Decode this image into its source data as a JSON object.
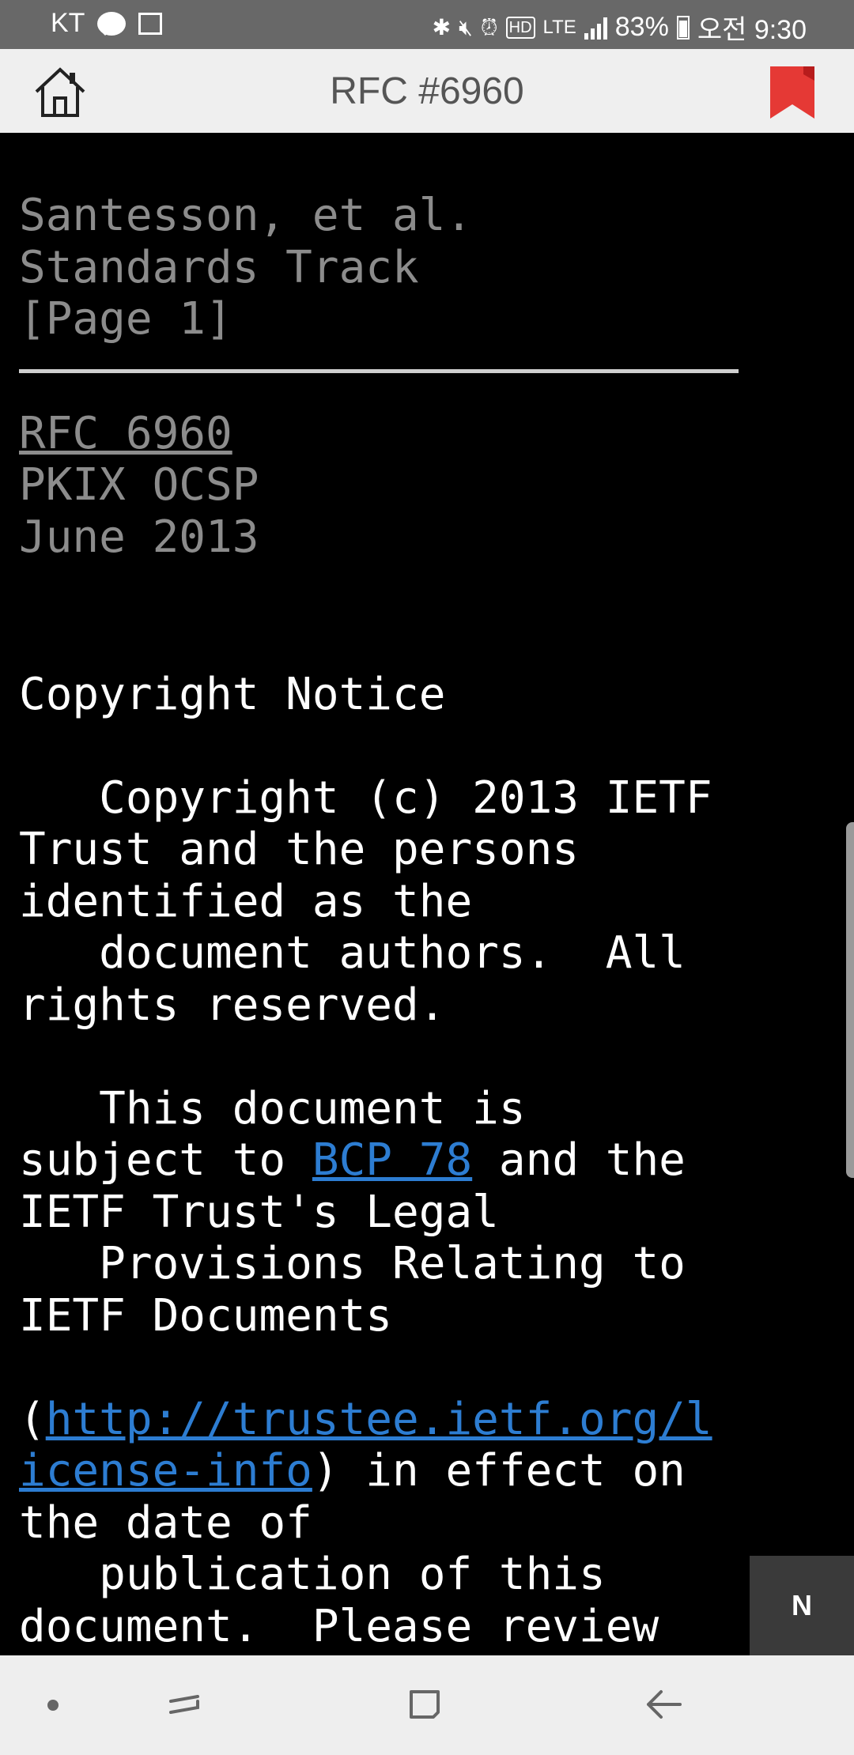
{
  "status_bar": {
    "carrier": "KT",
    "talk_icon_text": "TALK",
    "network": "LTE",
    "battery": "83%",
    "time": "오전 9:30"
  },
  "toolbar": {
    "title": "RFC #6960"
  },
  "document": {
    "footer_lines": [
      "Santesson, et al.",
      "Standards Track",
      "[Page 1]"
    ],
    "header_link": "RFC 6960",
    "header_lines": [
      "PKIX OCSP",
      "June 2013"
    ],
    "section_title": "Copyright Notice",
    "para1": [
      "   Copyright (c) 2013 IETF",
      "Trust and the persons",
      "identified as the",
      "   document authors.  All",
      "rights reserved."
    ],
    "para2_line1": "   This document is",
    "para2_l2_pre": "subject to ",
    "para2_l2_link": "BCP 78",
    "para2_l2_post": " and the",
    "para2_rest": [
      "IETF Trust's Legal",
      "   Provisions Relating to",
      "IETF Documents"
    ],
    "para3_open": "(",
    "para3_link_a": "http://trustee.ietf.org/l",
    "para3_link_b": "icense-info",
    "para3_l2_post": ") in effect on",
    "para3_rest": [
      "the date of",
      "   publication of this",
      "document.  Please review"
    ]
  },
  "floating_button": {
    "label": "N"
  },
  "colors": {
    "accent_bookmark": "#e53935",
    "link": "#2d7dd2",
    "muted_text": "#8c8c8c"
  }
}
